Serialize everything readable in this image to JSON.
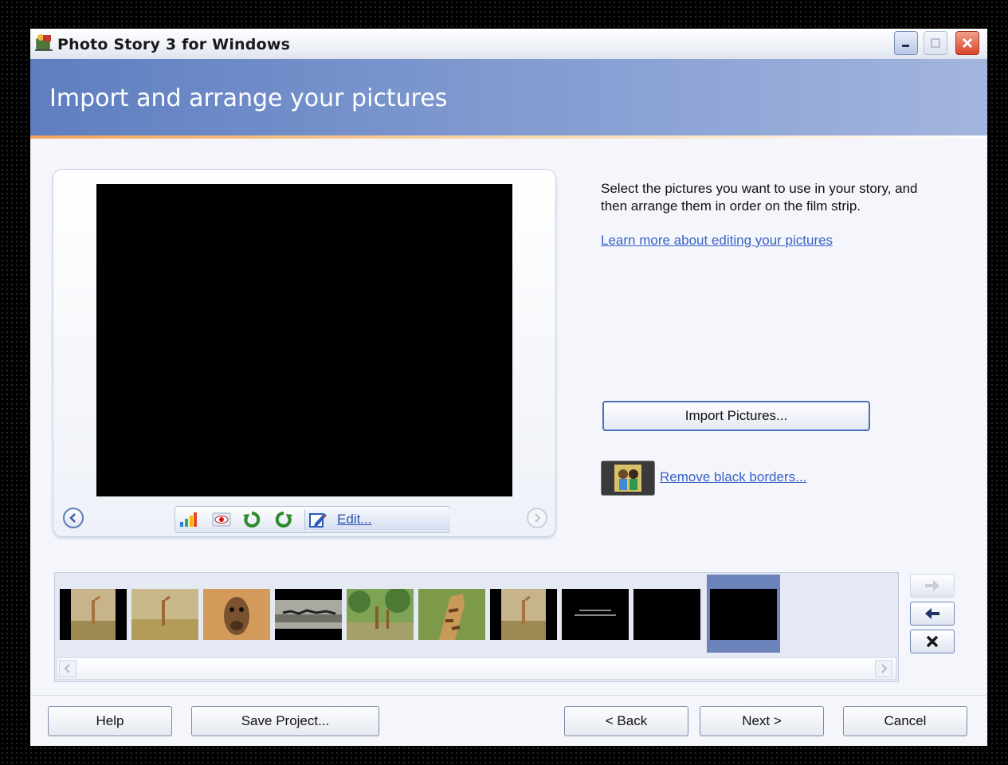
{
  "window": {
    "title": "Photo Story 3 for Windows"
  },
  "header": {
    "title": "Import and arrange your pictures"
  },
  "preview": {
    "edit_label": "Edit..."
  },
  "instructions": {
    "text": "Select the pictures you want to use in your story, and then arrange them in order on the film strip.",
    "learn_more_link": "Learn more about editing your pictures"
  },
  "actions": {
    "import_label": "Import Pictures...",
    "remove_borders_label": "Remove black borders..."
  },
  "filmstrip": {
    "thumbnails": [
      "giraffe-borders",
      "giraffe-plain",
      "giraffe-closeup",
      "zebra-herd",
      "giraffes-trees",
      "giraffe-head",
      "giraffe-borders",
      "text-slide",
      "black-slide",
      "black-slide-selected"
    ]
  },
  "footer": {
    "help_label": "Help",
    "save_label": "Save Project...",
    "back_label": "< Back",
    "next_label": "Next >",
    "cancel_label": "Cancel"
  },
  "colors": {
    "header_band": "#5e7ec0",
    "accent_link": "#3a62c6",
    "selected_thumb": "#6b82ba"
  }
}
